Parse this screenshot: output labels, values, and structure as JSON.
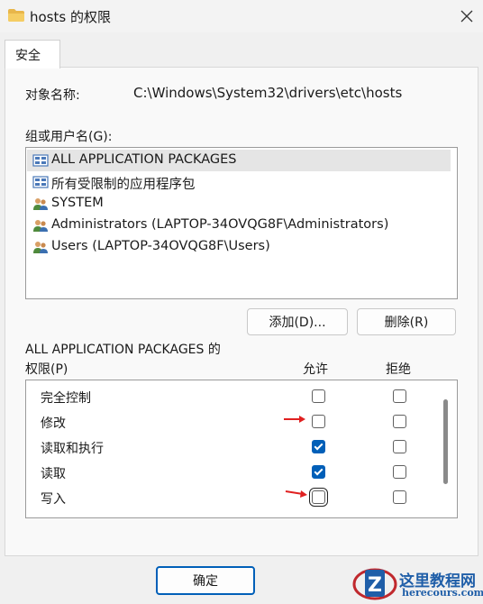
{
  "window": {
    "title": "hosts 的权限",
    "icon": "folder-icon",
    "close_icon": "close-icon"
  },
  "tabs": [
    {
      "label": "安全",
      "active": true
    }
  ],
  "object": {
    "label": "对象名称:",
    "value": "C:\\Windows\\System32\\drivers\\etc\\hosts"
  },
  "groups": {
    "label": "组或用户名(G):",
    "items": [
      {
        "name": "ALL APPLICATION PACKAGES",
        "icon": "package-group-icon",
        "selected": true
      },
      {
        "name": "所有受限制的应用程序包",
        "icon": "package-group-icon",
        "selected": false
      },
      {
        "name": "SYSTEM",
        "icon": "users-icon",
        "selected": false
      },
      {
        "name": "Administrators (LAPTOP-34OVQG8F\\Administrators)",
        "icon": "users-icon",
        "selected": false
      },
      {
        "name": "Users (LAPTOP-34OVQG8F\\Users)",
        "icon": "users-icon",
        "selected": false
      }
    ]
  },
  "buttons": {
    "add": "添加(D)...",
    "remove": "删除(R)",
    "ok": "确定"
  },
  "permissions": {
    "title_line1": "ALL APPLICATION PACKAGES 的",
    "title_line2": "权限(P)",
    "col_allow": "允许",
    "col_deny": "拒绝",
    "rows": [
      {
        "name": "完全控制",
        "allow": false,
        "deny": false
      },
      {
        "name": "修改",
        "allow": false,
        "deny": false
      },
      {
        "name": "读取和执行",
        "allow": true,
        "deny": false
      },
      {
        "name": "读取",
        "allow": true,
        "deny": false
      },
      {
        "name": "写入",
        "allow": false,
        "deny": false
      }
    ]
  },
  "watermark": {
    "text": "这里教程网",
    "sub": "herecours.com"
  },
  "colors": {
    "accent": "#005fb8",
    "annotation_arrow": "#e02020"
  }
}
